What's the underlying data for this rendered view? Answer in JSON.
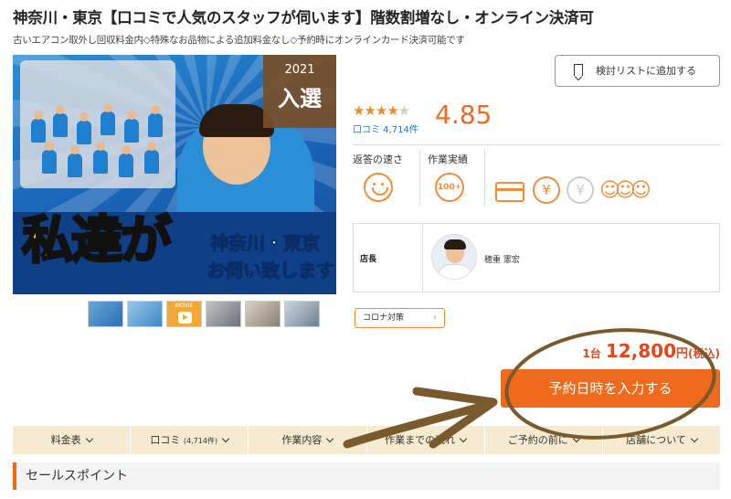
{
  "header": {
    "title": "神奈川・東京【口コミで人気のスタッフが伺います】階数割増なし・オンライン決済可",
    "subtitle": "古いエアコン取外し回収料金内◇特殊なお品物による追加料金なし◇予約時にオンラインカード決済可能です"
  },
  "hero": {
    "big_text": "私達が",
    "area_text": "神奈川・東京",
    "tagline": "お伺い致します!",
    "award_year": "2021",
    "award_label": "入選"
  },
  "thumbnails": {
    "movie_label": "MOVIE"
  },
  "rating": {
    "stars": 4.5,
    "reviews_label": "口コミ 4,714件",
    "score": "4.85"
  },
  "metrics": {
    "response_label": "返答の速さ",
    "jobs_label": "作業実績",
    "jobs_badge": "100+"
  },
  "manager": {
    "label": "店長",
    "name": "穂重 憲宏"
  },
  "corona_button": "コロナ対策",
  "bookmark_button": "検討リストに追加する",
  "price": {
    "unit": "1台",
    "amount": "12,800",
    "yen": "円",
    "tax": "(税込)"
  },
  "reserve_button": "予約日時を入力する",
  "tabs": [
    {
      "label": "料金表"
    },
    {
      "label": "口コミ",
      "sub": "(4,714件)"
    },
    {
      "label": "作業内容"
    },
    {
      "label": "作業までの流れ"
    },
    {
      "label": "ご予約の前に"
    },
    {
      "label": "店舗について"
    }
  ],
  "section_title": "セールスポイント",
  "colors": {
    "accent": "#ef6a1c",
    "score": "#f26a20",
    "tabbar": "#f6ead0",
    "annotation": "#7a5a2c"
  }
}
